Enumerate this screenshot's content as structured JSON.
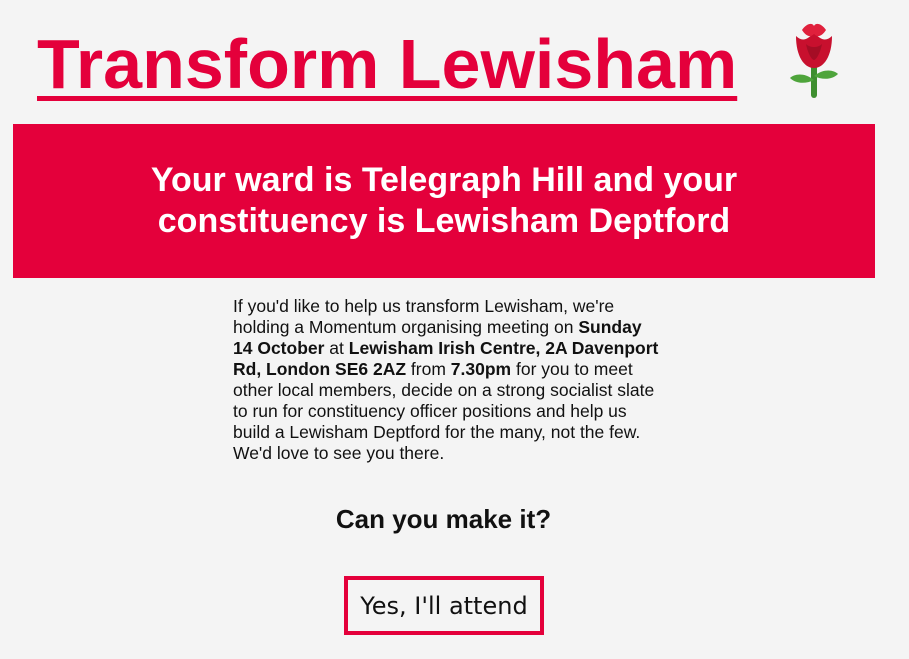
{
  "header": {
    "title": "Transform Lewisham",
    "logo_icon": "rose-icon"
  },
  "banner": {
    "text": "Your ward is Telegraph Hill and your constituency is Lewisham Deptford"
  },
  "invite": {
    "intro": "If you'd like to help us transform Lewisham, we're holding a Momentum organising meeting on ",
    "date": "Sunday 14 October",
    "at": " at ",
    "venue": "Lewisham Irish Centre, 2A Davenport Rd, London SE6 2AZ",
    "from": " from ",
    "time": "7.30pm",
    "outro": " for you to meet other local members, decide on a strong socialist slate to run for constituency officer positions and help us build a Lewisham Deptford for the many, not the few. We'd love to see you there."
  },
  "question": "Can you make it?",
  "attend_button": "Yes, I'll attend",
  "colors": {
    "accent": "#e4003b",
    "background": "#f4f4f4",
    "text": "#111111"
  }
}
